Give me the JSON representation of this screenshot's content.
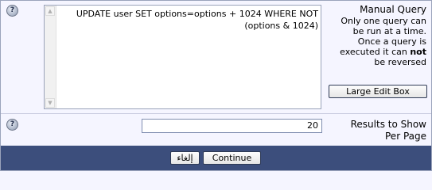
{
  "query_row": {
    "textarea_value": "UPDATE user SET options=options + 1024 WHERE NOT (options & 1024)",
    "title": "Manual Query",
    "desc_line1": "Only one query can",
    "desc_line2": "be run at a time.",
    "desc_line3": "Once a query is",
    "desc_line4_a": "executed it can",
    "desc_line4_bold": "not",
    "desc_line5": "be reversed",
    "large_edit_label": "Large Edit Box"
  },
  "results_row": {
    "value": "20",
    "label_line1": "Results to Show",
    "label_line2": "Per Page"
  },
  "footer": {
    "cancel_label": "إلغاء",
    "continue_label": "Continue"
  },
  "icons": {
    "help": "?"
  },
  "colors": {
    "footer_bg": "#3c4e7c",
    "panel_bg": "#f5f5ff"
  }
}
